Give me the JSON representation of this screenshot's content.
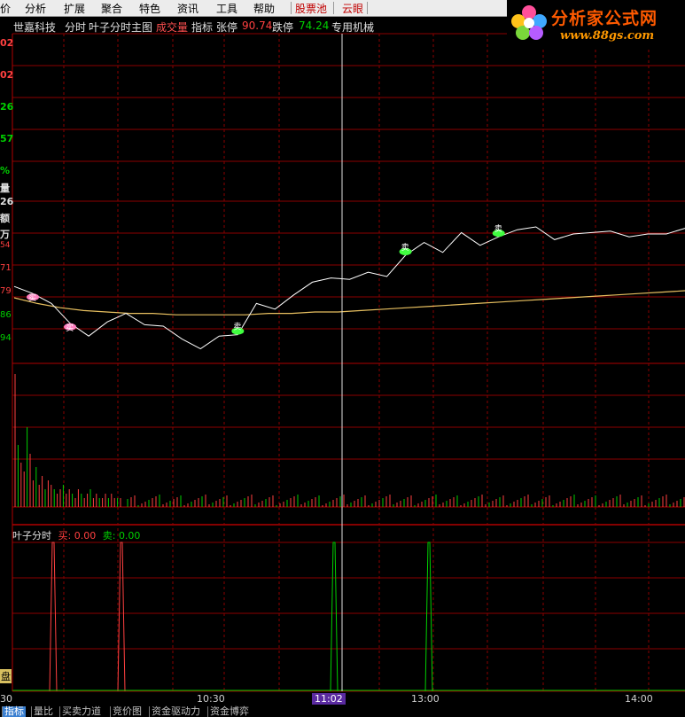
{
  "menu": {
    "items": [
      "价",
      "分析",
      "扩展",
      "聚合",
      "特色",
      "资讯",
      "工具",
      "帮助"
    ],
    "highlighted": [
      "股票池",
      "云眼"
    ]
  },
  "logo": {
    "title": "分析家公式网",
    "url": "www.88gs.com"
  },
  "header": {
    "stock": "世嘉科技",
    "mode": "分时",
    "indicator": "叶子分时主图",
    "chengjiao": "成交量",
    "zhibiao": "指标",
    "limit_up_label": "张停",
    "limit_up_value": "90.74",
    "limit_down_label": "跌停",
    "limit_down_value": "74.24",
    "sector": "专用机械"
  },
  "left_axis": [
    "02",
    "02",
    "26",
    "57",
    "%",
    "量",
    "26",
    "额",
    "万",
    "54",
    "71",
    "79",
    "86",
    "94"
  ],
  "indicator_panel": {
    "name": "叶子分时",
    "buy_label": "买:",
    "buy_value": "0.00",
    "sell_label": "卖:",
    "sell_value": "0.00"
  },
  "side_label": "盘",
  "time_axis": [
    "30",
    "10:30",
    "11:02",
    "13:00",
    "14:00"
  ],
  "tabs": [
    "指标",
    "量比",
    "买卖力道",
    "竞价图",
    "资金驱动力",
    "资金博弈"
  ],
  "colors": {
    "grid_red": "#8b0000",
    "price_line": "#ffffff",
    "avg_line": "#e8c060",
    "up": "#ff4040",
    "down": "#00d000",
    "buy_marker": "#ff80c0",
    "sell_marker": "#40ff40"
  },
  "chart_data": {
    "type": "line",
    "title": "叶子分时主图",
    "series": [
      {
        "values": [
          84.8,
          84.3,
          83.6,
          82.2,
          81.3,
          82.3,
          82.9,
          82.1,
          82.0,
          81.1,
          80.4,
          81.3,
          81.4,
          83.6,
          83.2,
          84.2,
          85.1,
          85.4,
          85.3,
          85.8,
          85.5,
          87.0,
          87.9,
          87.2,
          88.6,
          87.7,
          88.3,
          88.8,
          89.0,
          88.1,
          88.5,
          88.6,
          88.7,
          88.3,
          88.5,
          88.5,
          88.9
        ]
      },
      {
        "values": [
          84.0,
          83.6,
          83.3,
          83.1,
          83.0,
          82.9,
          82.9,
          82.8,
          82.8,
          82.8,
          82.8,
          82.9,
          82.9,
          83.0,
          83.0,
          83.1,
          83.2,
          83.3,
          83.4,
          83.5,
          83.6,
          83.7,
          83.8,
          83.9,
          84.0,
          84.1,
          84.2,
          84.3,
          84.4,
          84.5
        ]
      }
    ],
    "markers": [
      {
        "type": "buy",
        "label": "买"
      },
      {
        "type": "buy",
        "label": "买"
      },
      {
        "type": "sell",
        "label": "卖"
      },
      {
        "type": "sell",
        "label": "卖"
      },
      {
        "type": "sell",
        "label": "卖"
      }
    ],
    "volume": [
      30,
      14,
      10,
      8,
      18,
      12,
      6,
      9,
      5,
      7,
      4,
      6,
      5,
      4,
      3,
      4,
      5,
      3,
      4,
      3,
      2,
      4,
      3,
      2,
      3,
      4,
      2,
      3,
      2,
      2,
      3,
      2,
      3,
      2,
      2,
      2
    ],
    "signals": [
      {
        "type": "buy",
        "strength": 1.0
      },
      {
        "type": "buy",
        "strength": 1.0
      },
      {
        "type": "sell",
        "strength": 1.0
      },
      {
        "type": "sell",
        "strength": 1.0
      }
    ]
  }
}
